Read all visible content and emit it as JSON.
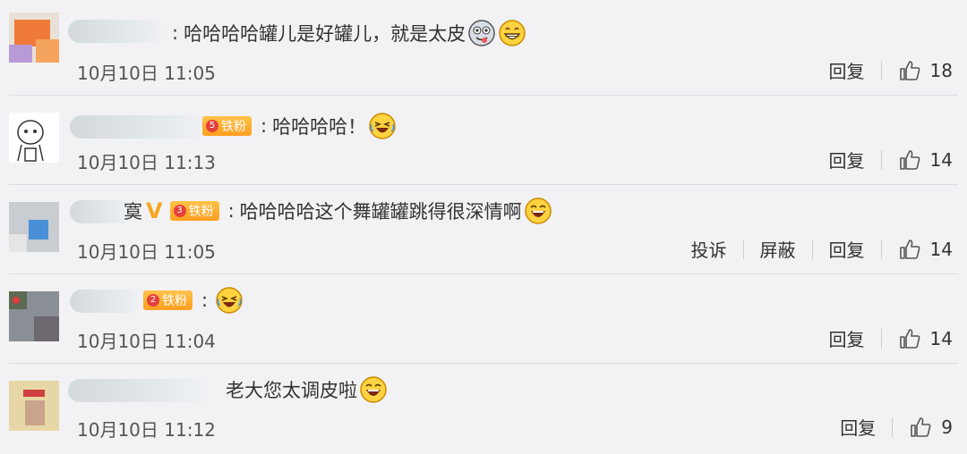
{
  "comments": [
    {
      "text": "哈哈哈哈罐儿是好罐儿，就是太皮",
      "emojis": [
        "silly-face-icon",
        "grin-icon"
      ],
      "time": "10月10日 11:05",
      "reply_label": "回复",
      "likes": "18"
    },
    {
      "badge": "铁粉",
      "badge_level": "5",
      "text": "哈哈哈哈！",
      "emojis": [
        "laugh-cry-icon"
      ],
      "time": "10月10日 11:13",
      "reply_label": "回复",
      "likes": "14"
    },
    {
      "name_fragment": "寞",
      "badge": "铁粉",
      "badge_level": "3",
      "text": "哈哈哈哈这个舞罐罐跳得很深情啊",
      "emojis": [
        "laugh-icon"
      ],
      "time": "10月10日 11:05",
      "report_label": "投诉",
      "block_label": "屏蔽",
      "reply_label": "回复",
      "likes": "14"
    },
    {
      "badge": "铁粉",
      "badge_level": "2",
      "text": "",
      "emojis": [
        "laugh-cry-icon"
      ],
      "time": "10月10日 11:04",
      "reply_label": "回复",
      "likes": "14"
    },
    {
      "text": "老大您太调皮啦",
      "emojis": [
        "laugh-icon"
      ],
      "time": "10月10日 11:12",
      "reply_label": "回复",
      "likes": "9"
    }
  ],
  "colors": {
    "background": "#f2f2f5",
    "badge": "#ff9e1f",
    "vip": "#f5a623",
    "divider": "#dcdce2"
  }
}
